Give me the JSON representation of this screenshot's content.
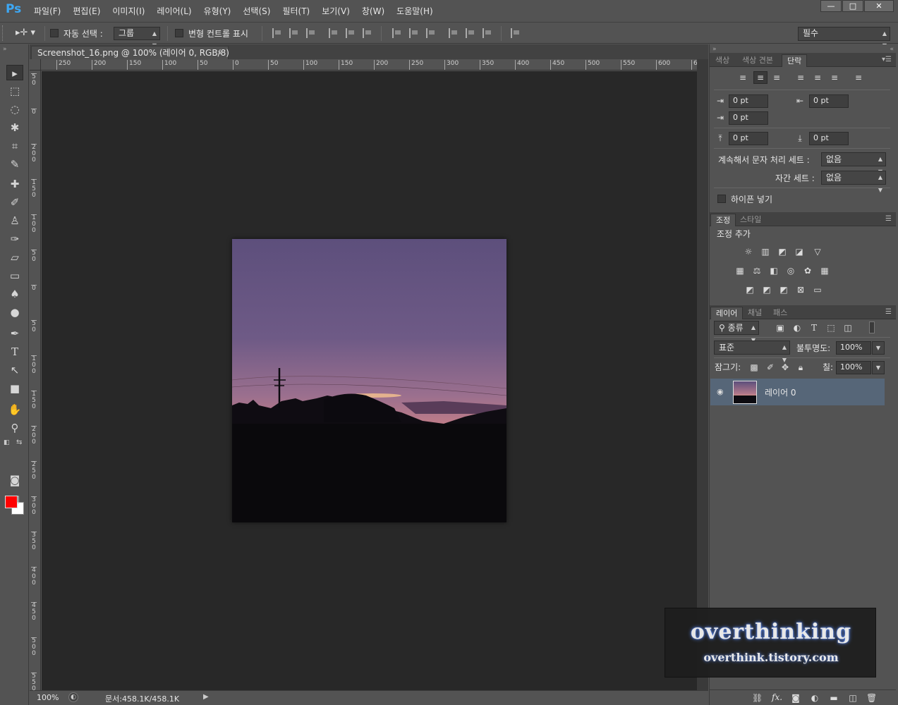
{
  "app": {
    "logo": "Ps",
    "menu": [
      "파일(F)",
      "편집(E)",
      "이미지(I)",
      "레이어(L)",
      "유형(Y)",
      "선택(S)",
      "필터(T)",
      "보기(V)",
      "창(W)",
      "도움말(H)"
    ]
  },
  "window_controls": {
    "minimize": "—",
    "maximize": "□",
    "close": "✕"
  },
  "options_bar": {
    "auto_select_label": "자동 선택 :",
    "auto_select_value": "그룹",
    "transform_controls_label": "변형 컨트롤 표시",
    "workspace_value": "필수"
  },
  "document": {
    "tab_title": "Screenshot_16.png @ 100% (레이어 0, RGB/8)",
    "tab_close": "×",
    "zoom": "100%",
    "doc_size": "문서:458.1K/458.1K"
  },
  "ruler": {
    "h_labels": [
      "250",
      "200",
      "150",
      "100",
      "50",
      "0",
      "50",
      "100",
      "150",
      "200",
      "250",
      "300",
      "350",
      "400",
      "450",
      "500",
      "550",
      "600",
      "6"
    ],
    "v_labels": [
      "50",
      "0",
      "200",
      "150",
      "100",
      "50",
      "0",
      "50",
      "100",
      "150",
      "200",
      "250",
      "300",
      "350",
      "400",
      "450",
      "500",
      "550",
      "600"
    ]
  },
  "paragraph_panel": {
    "tabs": [
      "색상",
      "색상 견본",
      "단락"
    ],
    "active_tab": "단락",
    "indent_left": "0 pt",
    "indent_right": "0 pt",
    "indent_first": "0 pt",
    "space_before": "0 pt",
    "space_after": "0 pt",
    "kinsoku_label": "계속해서 문자 처리 세트 :",
    "kinsoku_value": "없음",
    "mojikumi_label": "자간 세트 :",
    "mojikumi_value": "없음",
    "hyphenate_label": "하이픈 넣기"
  },
  "adjust_panel": {
    "tabs": [
      "조정",
      "스타일"
    ],
    "active_tab": "조정",
    "title": "조정 추가"
  },
  "layers_panel": {
    "tabs": [
      "레이어",
      "채널",
      "패스"
    ],
    "active_tab": "레이어",
    "filter_kind": "종류",
    "blend_mode": "표준",
    "opacity_label": "불투명도:",
    "opacity_value": "100%",
    "lock_label": "잠그기:",
    "fill_label": "칠:",
    "fill_value": "100%",
    "layers": [
      {
        "name": "레이어 0"
      }
    ],
    "footer_fx": "fx."
  },
  "watermark": {
    "title": "overthinking",
    "url": "overthink.tistory.com"
  },
  "colors": {
    "foreground": "#ff0000",
    "background": "#ffffff",
    "panel_bg": "#535353",
    "canvas_bg": "#282828",
    "selected_layer": "#566678"
  }
}
